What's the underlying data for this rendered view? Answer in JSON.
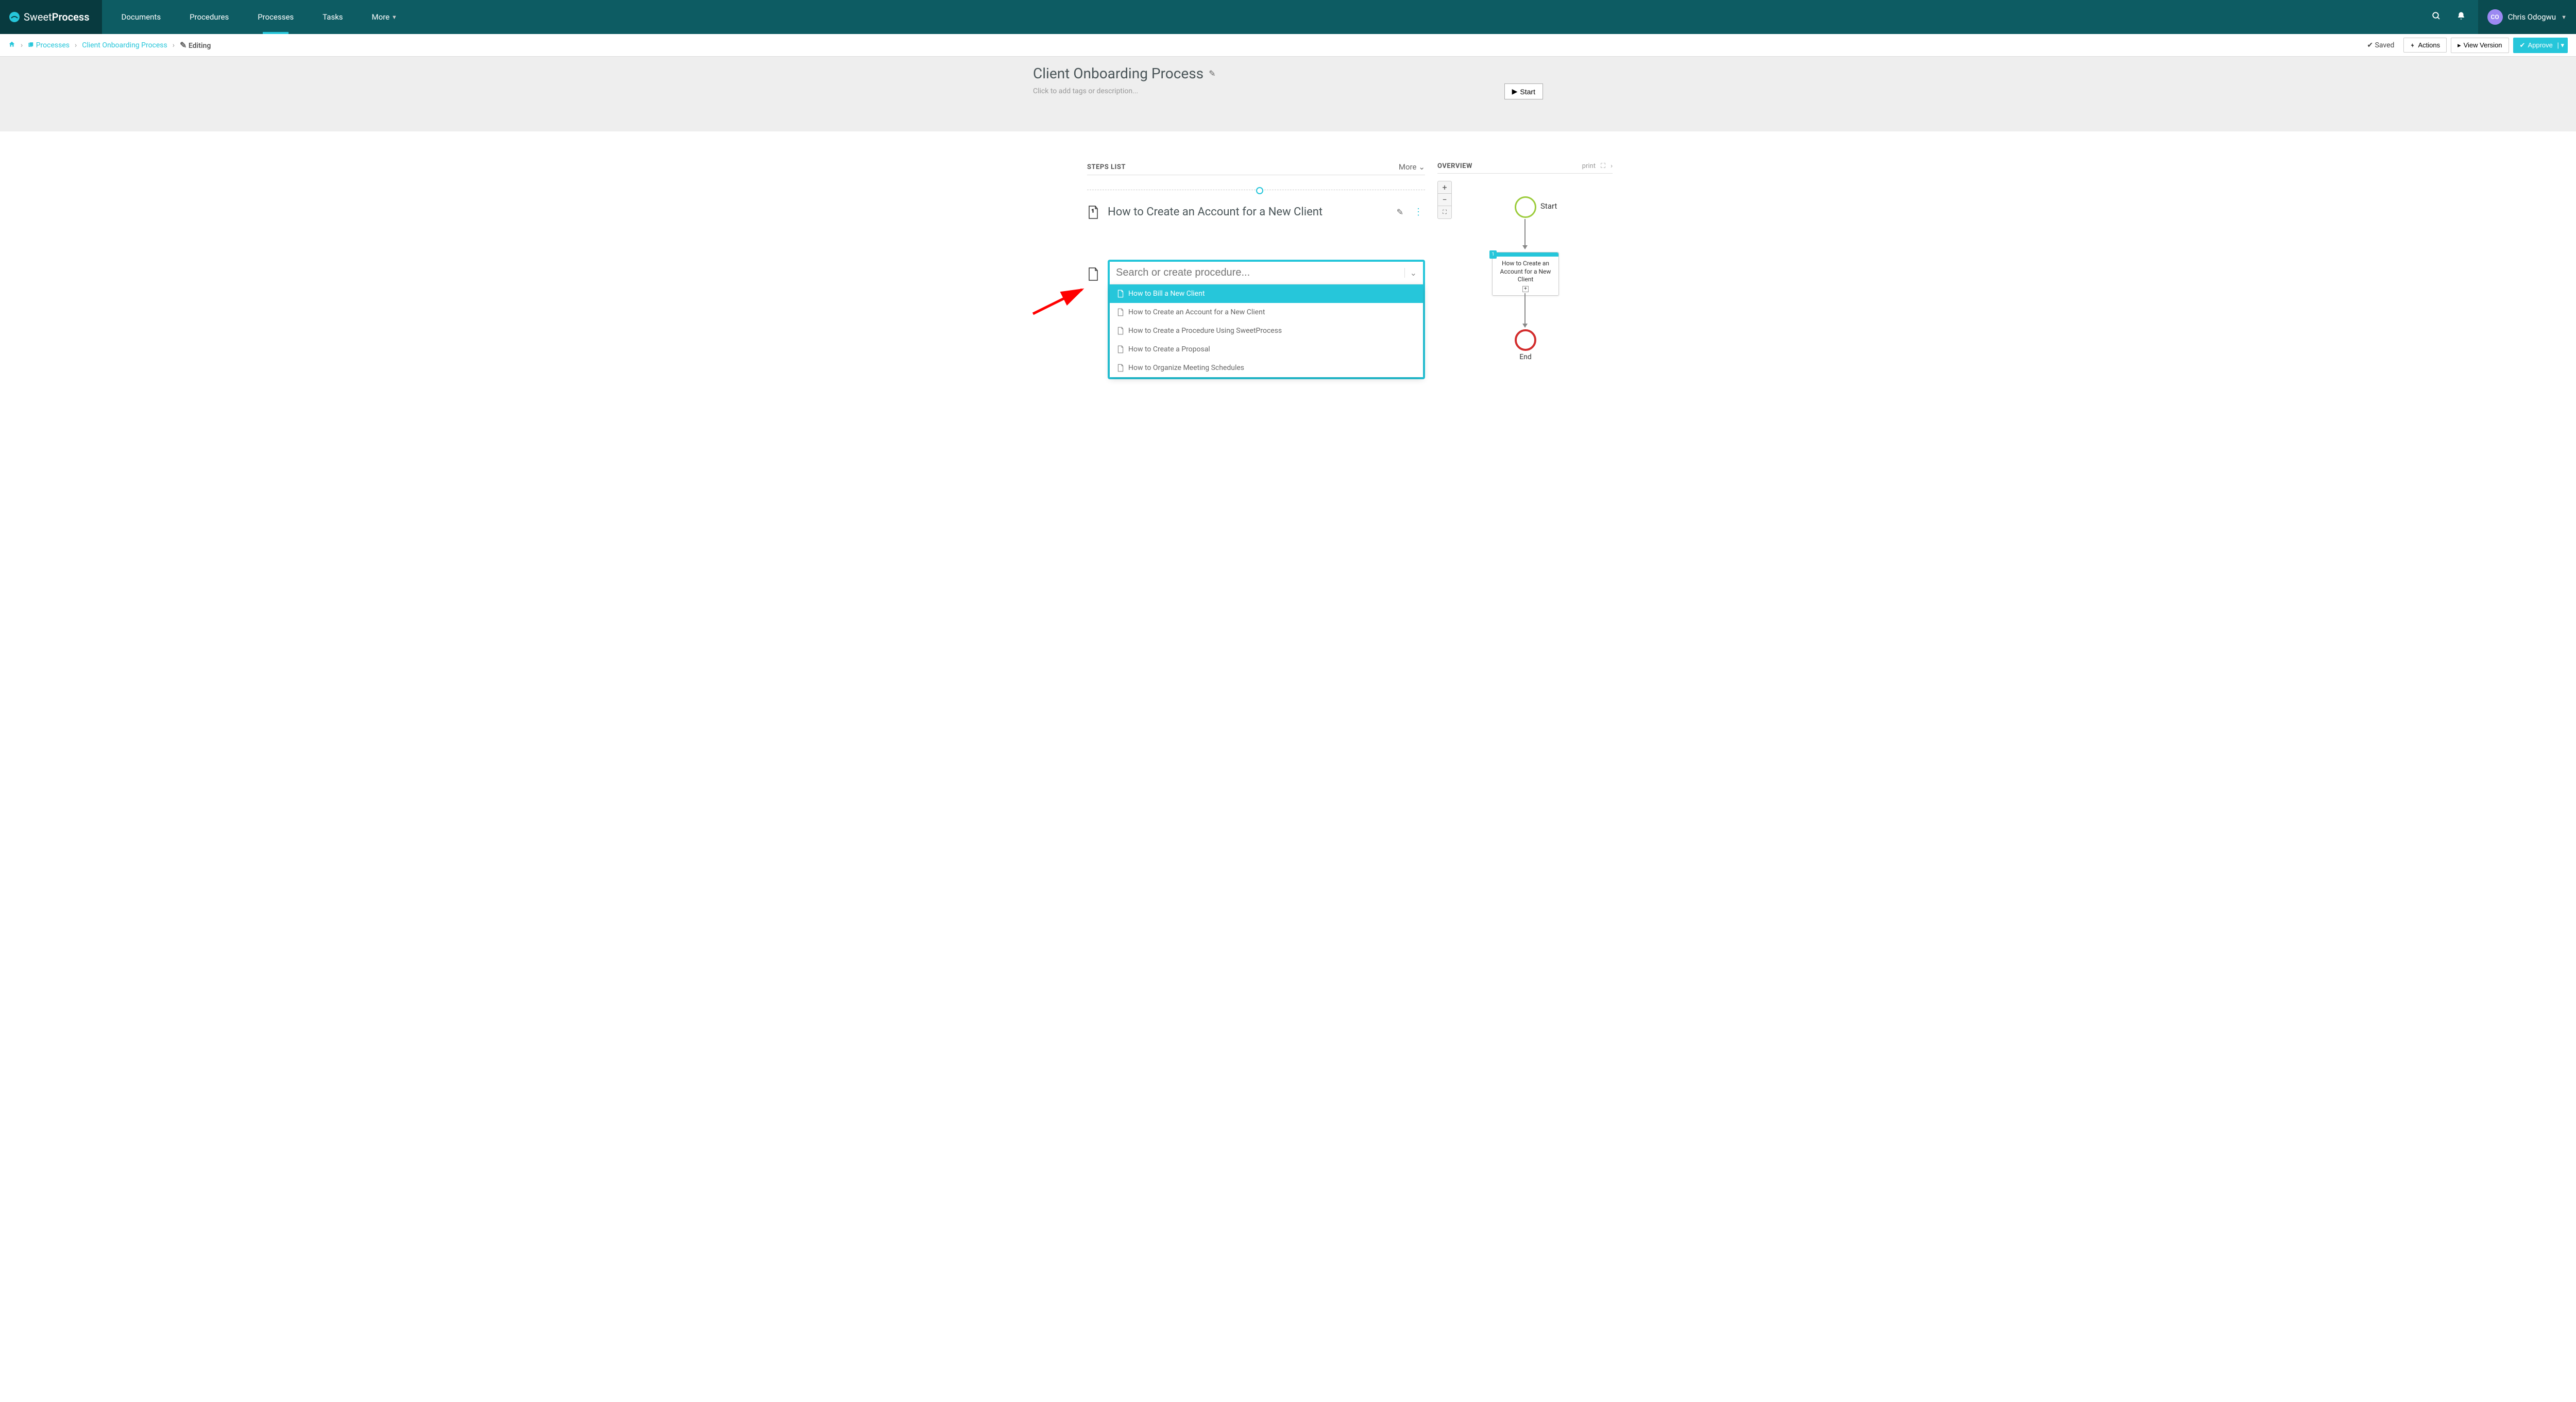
{
  "brand": {
    "name1": "Sweet",
    "name2": "Process"
  },
  "nav": {
    "items": [
      "Documents",
      "Procedures",
      "Processes",
      "Tasks",
      "More"
    ],
    "activeIndex": 2
  },
  "user": {
    "initials": "CO",
    "name": "Chris Odogwu"
  },
  "breadcrumb": {
    "home": "Home",
    "section": "Processes",
    "item": "Client Onboarding Process",
    "state": "Editing"
  },
  "actions": {
    "saved": "Saved",
    "actions": "Actions",
    "viewVersion": "View Version",
    "approve": "Approve"
  },
  "header": {
    "title": "Client Onboarding Process",
    "tagPlaceholder": "Click to add tags or description...",
    "start": "Start"
  },
  "steps": {
    "title": "STEPS LIST",
    "more": "More",
    "items": [
      {
        "title": "How to Create an Account for a New Client"
      }
    ],
    "searchPlaceholder": "Search or create procedure...",
    "dropdown": [
      "How to Bill a New Client",
      "How to Create an Account for a New Client",
      "How to Create a Procedure Using SweetProcess",
      "How to Create a Proposal",
      "How to Organize Meeting Schedules"
    ],
    "selectedDropdownIndex": 0
  },
  "overview": {
    "title": "OVERVIEW",
    "print": "print",
    "flow": {
      "start": "Start",
      "card": "How to Create an Account for a New Client",
      "end": "End"
    }
  }
}
